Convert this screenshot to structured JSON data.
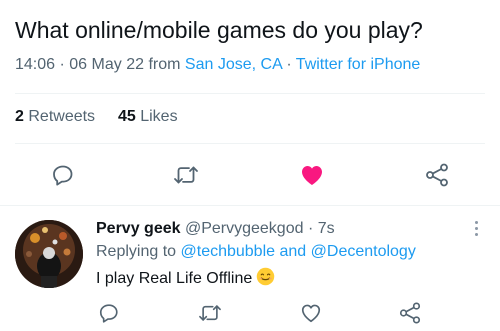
{
  "tweet": {
    "text": "What online/mobile games do you play?",
    "time": "14:06",
    "date_sep": "·",
    "date": "06 May 22",
    "from_label": "from",
    "location": "San Jose, CA",
    "source_sep": "·",
    "source": "Twitter for iPhone",
    "retweets_count": "2",
    "retweets_label": "Retweets",
    "likes_count": "45",
    "likes_label": "Likes",
    "liked": true
  },
  "colors": {
    "accent": "#1d9bf0",
    "like": "#f91880",
    "text": "#0f1419",
    "muted": "#536471"
  },
  "actions": {
    "reply_icon": "reply-bubble-icon",
    "retweet_icon": "retweet-icon",
    "like_icon": "heart-icon",
    "share_icon": "share-icon"
  },
  "reply": {
    "name": "Pervy geek",
    "handle": "@Pervygeekgod",
    "dot": "·",
    "time": "7s",
    "replying_to_label": "Replying to",
    "replying_to_user1": "@techbubble",
    "replying_and": "and",
    "replying_to_user2": "@Decentology",
    "text": "I play Real Life Offline",
    "emoji": "smiling-face-emoji"
  }
}
